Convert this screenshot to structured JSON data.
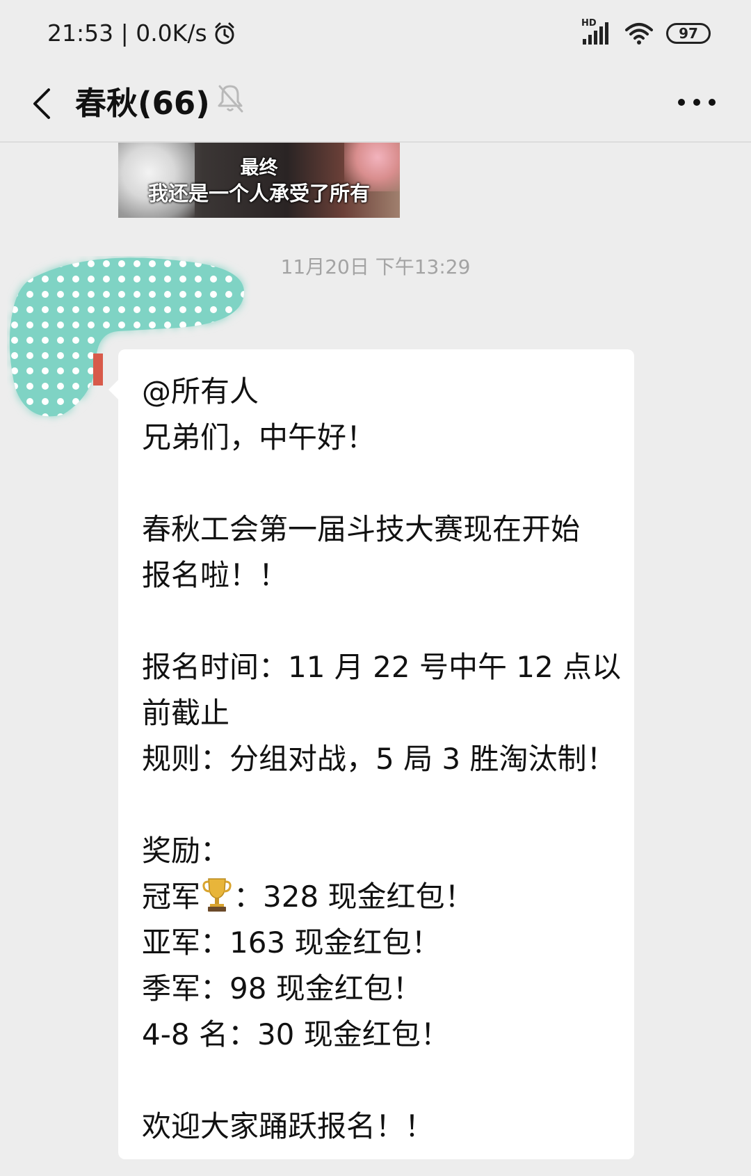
{
  "status_bar": {
    "time_speed": "21:53 | 0.0K/s",
    "network_badge": "HD",
    "battery": "97",
    "icons": [
      "alarm-icon",
      "signal-icon",
      "wifi-icon",
      "battery-icon"
    ]
  },
  "header": {
    "title": "春秋(66)",
    "icons": [
      "back-arrow-icon",
      "mute-bell-icon",
      "more-icon"
    ]
  },
  "image_message": {
    "caption_line1": "最终",
    "caption_line2": "我还是一个人承受了所有"
  },
  "timestamp": "11月20日 下午13:29",
  "message": {
    "lines": [
      "@所有人",
      "兄弟们，中午好！",
      "",
      "春秋工会第一届斗技大赛现在开始",
      "报名啦！！",
      "",
      "报名时间：11 月 22 号中午 12 点以",
      "前截止",
      "规则：分组对战，5 局 3 胜淘汰制！",
      "",
      "奖励：",
      "",
      "亚军：163 现金红包！",
      "季军：98 现金红包！",
      "4-8 名：30 现金红包！",
      "",
      "欢迎大家踊跃报名！！"
    ],
    "champion_prefix": "冠军",
    "champion_suffix": "：328 现金红包！",
    "champion_icon": "trophy-icon"
  },
  "colors": {
    "background": "#ededed",
    "bubble": "#ffffff",
    "timestamp_text": "#a3a3a3",
    "avatar_mask": "#7fd3c4"
  }
}
